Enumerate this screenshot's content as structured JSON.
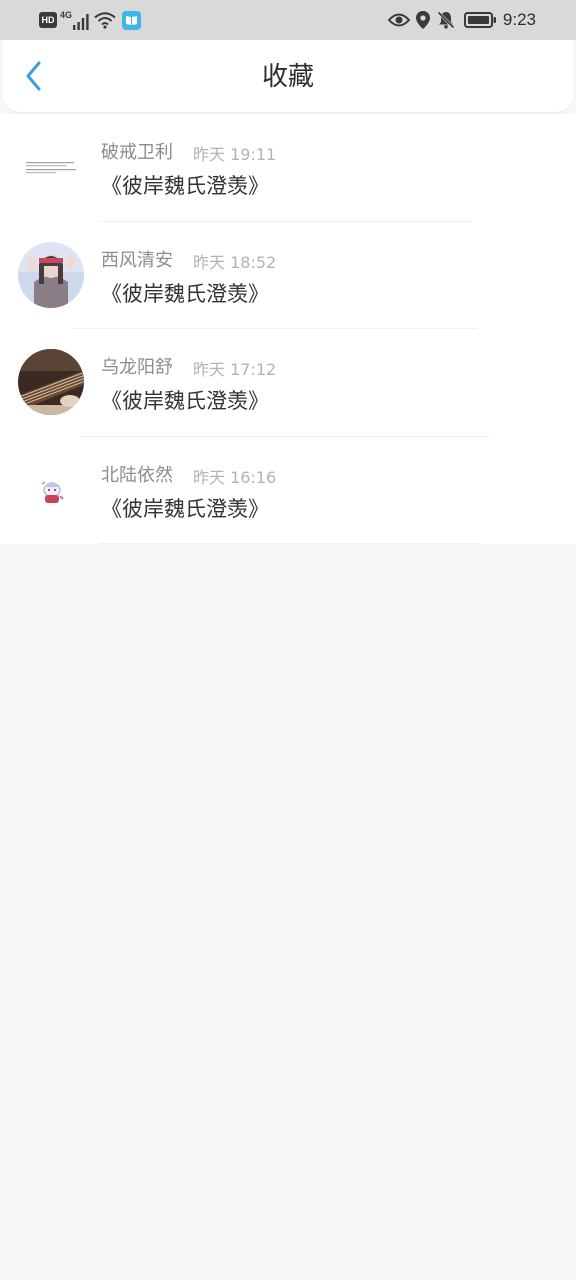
{
  "status_bar": {
    "hd": "HD",
    "network": "4G",
    "time": "9:23",
    "icons": [
      "signal-icon",
      "wifi-icon",
      "app-book-icon",
      "eye-icon",
      "location-icon",
      "bell-off-icon",
      "battery-icon"
    ]
  },
  "header": {
    "title": "收藏",
    "back_icon": "chevron-left-icon"
  },
  "favorites": [
    {
      "name": "破戒卫利",
      "time": "昨天 19:11",
      "title": "《彼岸魏氏澄羡》",
      "avatar": "text-avatar"
    },
    {
      "name": "西风清安",
      "time": "昨天 18:52",
      "title": "《彼岸魏氏澄羡》",
      "avatar": "girl-photo-avatar"
    },
    {
      "name": "乌龙阳舒",
      "time": "昨天 17:12",
      "title": "《彼岸魏氏澄羡》",
      "avatar": "guqin-photo-avatar"
    },
    {
      "name": "北陆依然",
      "time": "昨天 16:16",
      "title": "《彼岸魏氏澄羡》",
      "avatar": "cartoon-avatar"
    }
  ],
  "colors": {
    "accent": "#3a9ee0",
    "page_background": "#f8f7f8",
    "status_bar": "#d9d9d9",
    "name_text": "#8c8c8c",
    "time_text": "#b3b3b3",
    "title_text": "#333333"
  }
}
